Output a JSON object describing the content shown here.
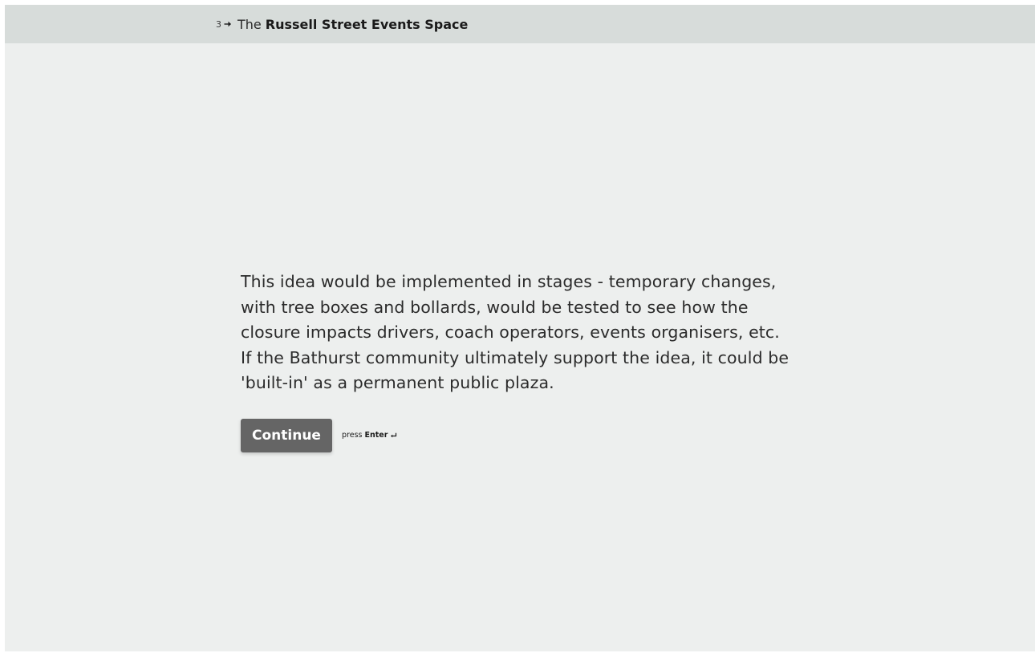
{
  "header": {
    "question_number": "3",
    "arrow_icon": "arrow-right-icon",
    "title_prefix": "The",
    "title_bold": "Russell Street Events Space"
  },
  "main": {
    "paragraph": "This idea would be implemented in stages - temporary changes, with tree boxes and bollards, would be tested to see how the closure impacts drivers, coach operators, events organisers, etc. If the Bathurst community ultimately support the idea, it could be 'built-in' as a permanent public plaza.",
    "continue_label": "Continue",
    "hint_prefix": "press",
    "hint_key": "Enter",
    "enter_icon": "enter-return-icon"
  },
  "colors": {
    "background": "#edefee",
    "header_background": "#d7dcda",
    "button_background": "#656565",
    "button_text": "#ffffff",
    "text": "#2b2b2b"
  }
}
